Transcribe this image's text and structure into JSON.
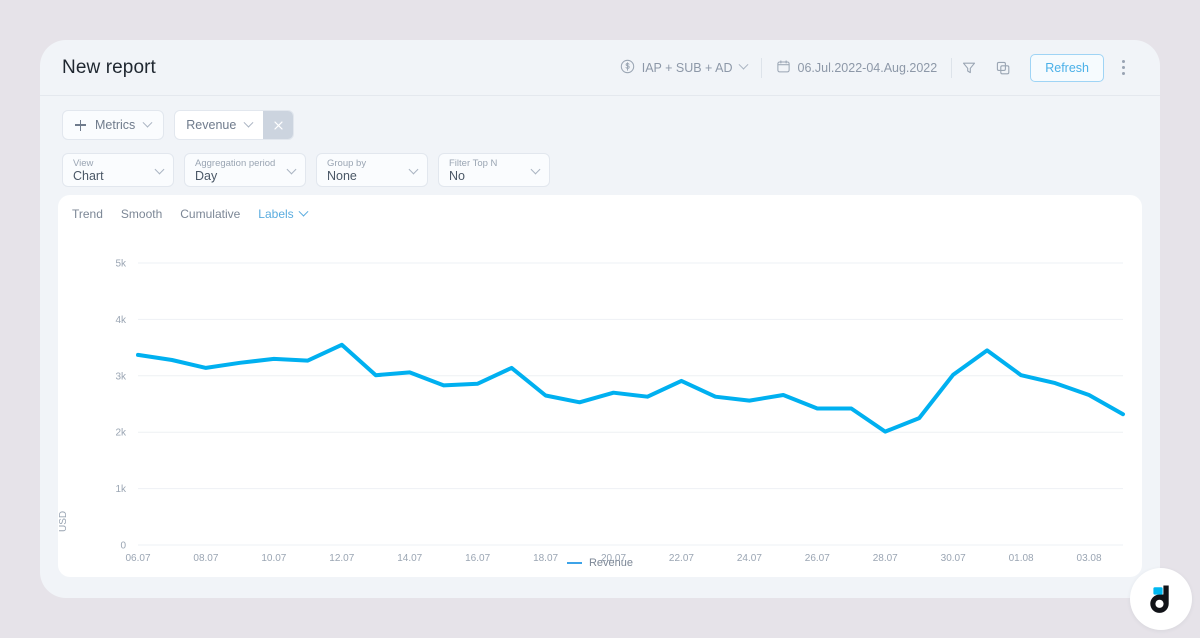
{
  "header": {
    "title": "New report",
    "platform_icon": "dollar-circle-icon",
    "platform_label": "IAP + SUB + AD",
    "calendar_icon": "calendar-icon",
    "date_range": "06.Jul.2022-04.Aug.2022",
    "filter_icon": "funnel-icon",
    "duplicate_icon": "copy-icon",
    "refresh_label": "Refresh",
    "more_icon": "kebab-menu-icon"
  },
  "metrics": {
    "add_label": "Metrics",
    "chips": [
      {
        "label": "Revenue",
        "remove_icon": "close-icon"
      }
    ]
  },
  "controls": [
    {
      "label": "View",
      "value": "Chart"
    },
    {
      "label": "Aggregation period",
      "value": "Day"
    },
    {
      "label": "Group by",
      "value": "None"
    },
    {
      "label": "Filter Top N",
      "value": "No"
    }
  ],
  "chart_options": {
    "trend": "Trend",
    "smooth": "Smooth",
    "cumulative": "Cumulative",
    "labels": "Labels"
  },
  "brand": {
    "logo_icon": "devtodev-d-logo",
    "logo_accent_color": "#00b8f1"
  },
  "chart_data": {
    "type": "line",
    "title": "",
    "xlabel": "",
    "ylabel": "USD",
    "ylim": [
      0,
      5000
    ],
    "ytick_values": [
      0,
      1000,
      2000,
      3000,
      4000,
      5000
    ],
    "ytick_labels": [
      "0",
      "1k",
      "2k",
      "3k",
      "4k",
      "5k"
    ],
    "grid": true,
    "legend_position": "bottom",
    "line_color": "#00b0f0",
    "x": [
      "06.07",
      "07.07",
      "08.07",
      "09.07",
      "10.07",
      "11.07",
      "12.07",
      "13.07",
      "14.07",
      "15.07",
      "16.07",
      "17.07",
      "18.07",
      "19.07",
      "20.07",
      "21.07",
      "22.07",
      "23.07",
      "24.07",
      "25.07",
      "26.07",
      "27.07",
      "28.07",
      "29.07",
      "30.07",
      "31.07",
      "01.08",
      "02.08",
      "03.08",
      "04.08"
    ],
    "xtick_labels": [
      "06.07",
      "08.07",
      "10.07",
      "12.07",
      "14.07",
      "16.07",
      "18.07",
      "20.07",
      "22.07",
      "24.07",
      "26.07",
      "28.07",
      "30.07",
      "01.08",
      "03.08"
    ],
    "series": [
      {
        "name": "Revenue",
        "values": [
          3370,
          3280,
          3140,
          3230,
          3300,
          3270,
          3550,
          3010,
          3060,
          2830,
          2860,
          3140,
          2650,
          2530,
          2700,
          2630,
          2910,
          2630,
          2560,
          2660,
          2420,
          2420,
          2010,
          2250,
          3020,
          3450,
          3010,
          2870,
          2660,
          2320
        ]
      }
    ]
  }
}
